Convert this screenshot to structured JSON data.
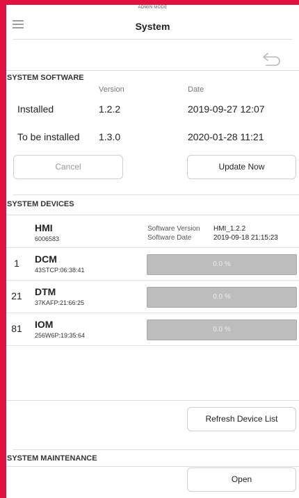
{
  "admin_banner": "ADMIN MODE",
  "header": {
    "title": "System"
  },
  "software": {
    "section_title": "SYSTEM SOFTWARE",
    "col_version": "Version",
    "col_date": "Date",
    "rows": [
      {
        "label": "Installed",
        "version": "1.2.2",
        "date": "2019-09-27 12:07"
      },
      {
        "label": "To be installed",
        "version": "1.3.0",
        "date": "2020-01-28 11:21"
      }
    ],
    "cancel_label": "Cancel",
    "update_label": "Update Now"
  },
  "devices": {
    "section_title": "SYSTEM DEVICES",
    "hmi": {
      "name": "HMI",
      "id": "6006583",
      "sw_version_label": "Software Version",
      "sw_version_value": "HMI_1.2.2",
      "sw_date_label": "Software Date",
      "sw_date_value": "2019-09-18 21:15:23"
    },
    "rows": [
      {
        "index": "1",
        "name": "DCM",
        "id": "43STCP:06:38:41",
        "progress_text": "0.0 %",
        "progress": 0.0
      },
      {
        "index": "21",
        "name": "DTM",
        "id": "37KAFP:21:66:25",
        "progress_text": "0.0 %",
        "progress": 0.0
      },
      {
        "index": "81",
        "name": "IOM",
        "id": "256W6P:19:35:64",
        "progress_text": "0.0 %",
        "progress": 0.0
      }
    ],
    "refresh_label": "Refresh Device List"
  },
  "maintenance": {
    "section_title": "SYSTEM MAINTENANCE",
    "open_label": "Open"
  },
  "colors": {
    "frame_border": "#e0103f",
    "progress_bg": "#bdbdbd",
    "progress_fill": "#8ab4f8"
  },
  "icons": {
    "menu": "hamburger-menu-icon",
    "back": "back-arrow-icon"
  }
}
